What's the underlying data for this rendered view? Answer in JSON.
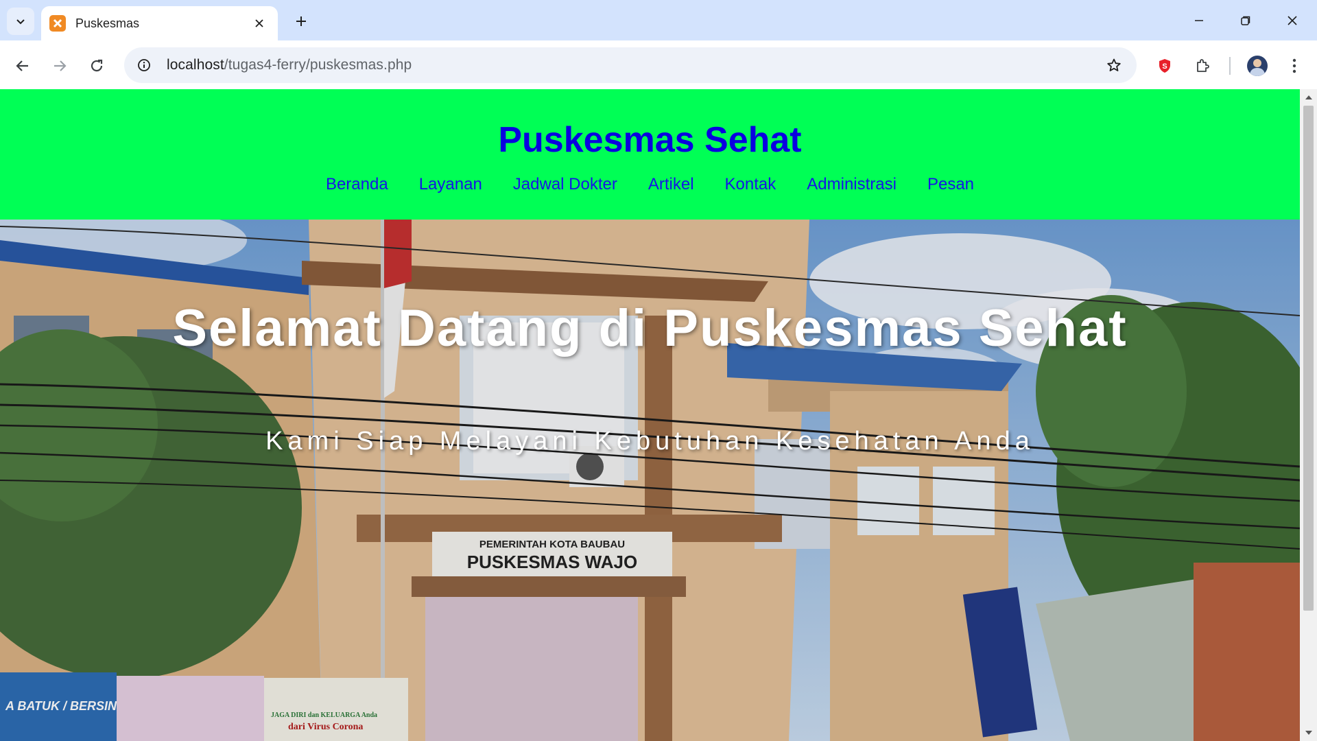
{
  "browser": {
    "tab_title": "Puskesmas",
    "url_host": "localhost",
    "url_path": "/tugas4-ferry/puskesmas.php"
  },
  "site": {
    "title": "Puskesmas Sehat",
    "nav": [
      "Beranda",
      "Layanan",
      "Jadwal Dokter",
      "Artikel",
      "Kontak",
      "Administrasi",
      "Pesan"
    ]
  },
  "hero": {
    "title": "Selamat Datang di Puskesmas Sehat",
    "subtitle": "Kami Siap Melayani Kebutuhan Kesehatan Anda",
    "photo_signs": {
      "sign_line1": "PEMERINTAH KOTA BAUBAU",
      "sign_line2": "PUSKESMAS WAJO",
      "banner_left": "A BATUK / BERSIN",
      "banner_right_1": "JAGA DIRI dan KELUARGA Anda",
      "banner_right_2": "dari Virus Corona"
    }
  },
  "colors": {
    "header_bg": "#00ff55",
    "title_color": "#0a00e0",
    "nav_color": "#1515e6",
    "hero_text": "#ffffff"
  }
}
